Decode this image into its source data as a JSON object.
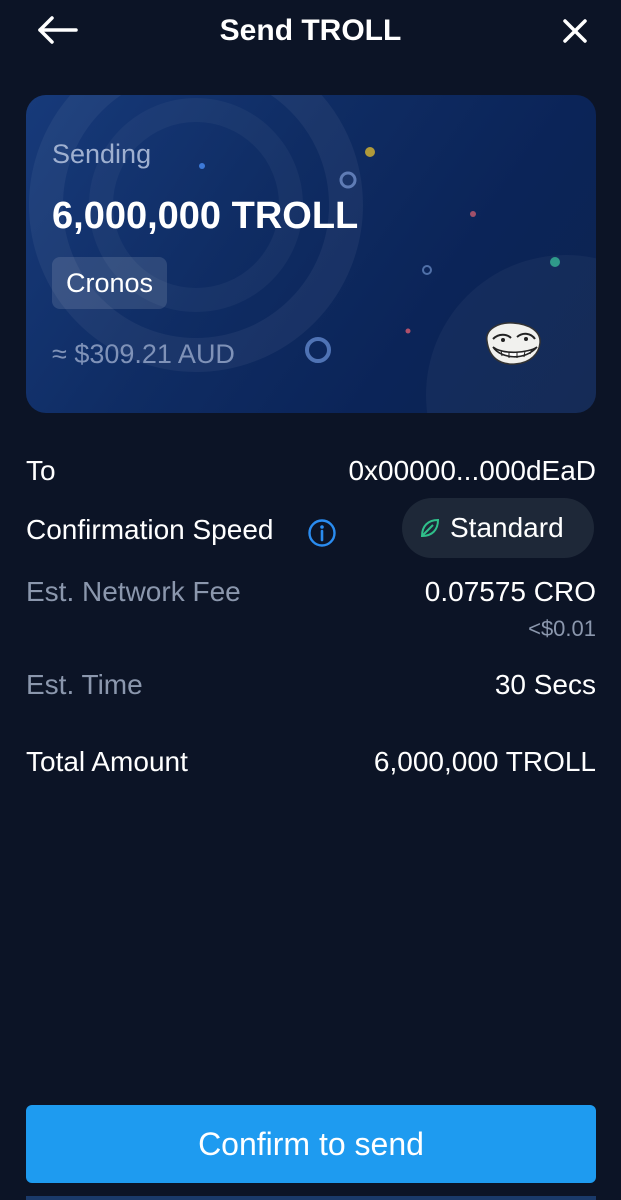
{
  "header": {
    "title": "Send TROLL",
    "back_icon": "arrow-left-icon",
    "close_icon": "close-icon"
  },
  "card": {
    "label": "Sending",
    "amount": "6,000,000 TROLL",
    "network": "Cronos",
    "fiat_value": "≈ $309.21 AUD",
    "token_icon": "troll-face-logo"
  },
  "details": {
    "to_label": "To",
    "to_value": "0x00000...000dEaD",
    "speed_label": "Confirmation Speed",
    "speed_info_icon": "info-icon",
    "speed_value": "Standard",
    "speed_icon": "leaf-icon",
    "fee_label": "Est. Network Fee",
    "fee_value": "0.07575 CRO",
    "fee_fiat": "<$0.01",
    "time_label": "Est. Time",
    "time_value": "30 Secs",
    "total_label": "Total Amount",
    "total_value": "6,000,000 TROLL"
  },
  "actions": {
    "confirm_label": "Confirm to send"
  },
  "colors": {
    "background": "#0c1426",
    "card": "#0f2c63",
    "accent": "#1e9bf0",
    "muted_text": "#8b97ad",
    "leaf": "#2fbf8a"
  }
}
